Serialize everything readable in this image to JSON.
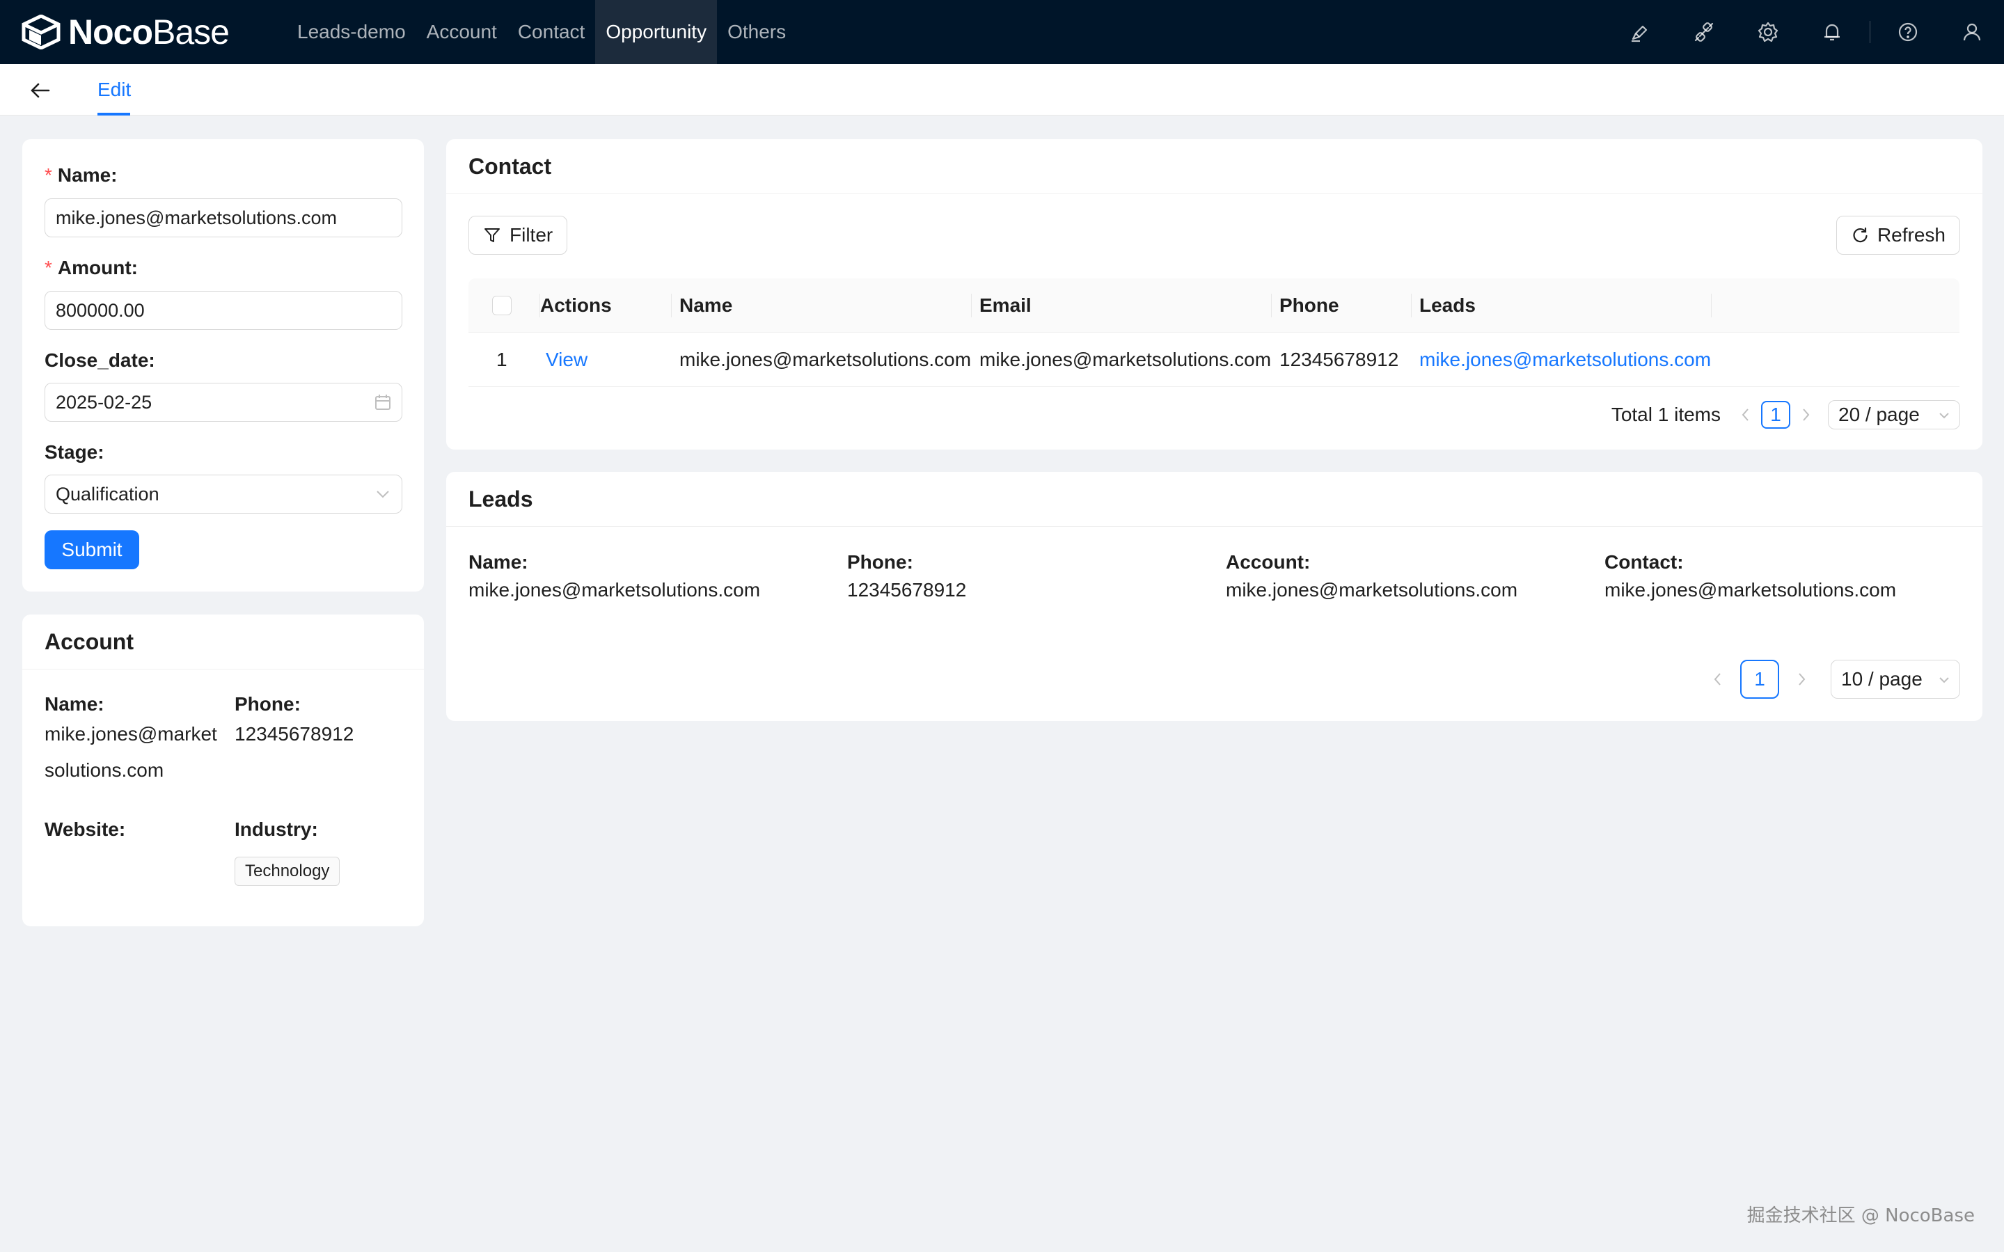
{
  "brand": {
    "name_bold": "Noco",
    "name_light": "Base"
  },
  "nav": [
    {
      "label": "Leads-demo"
    },
    {
      "label": "Account"
    },
    {
      "label": "Contact"
    },
    {
      "label": "Opportunity",
      "active": true
    },
    {
      "label": "Others"
    }
  ],
  "top_icons": [
    "ui-editor-icon",
    "plugin-icon",
    "settings-icon",
    "notification-bell-icon",
    "help-icon",
    "user-icon"
  ],
  "subheader": {
    "tab": "Edit"
  },
  "form": {
    "name_label": "Name",
    "name_value": "mike.jones@marketsolutions.com",
    "amount_label": "Amount",
    "amount_value": "800000.00",
    "close_date_label": "Close_date",
    "close_date_value": "2025-02-25",
    "stage_label": "Stage",
    "stage_value": "Qualification",
    "submit_label": "Submit"
  },
  "account": {
    "title": "Account",
    "name_label": "Name",
    "name_value": "mike.jones@marketsolutions.com",
    "phone_label": "Phone",
    "phone_value": "12345678912",
    "website_label": "Website",
    "website_value": "",
    "industry_label": "Industry",
    "industry_value": "Technology"
  },
  "contact": {
    "title": "Contact",
    "filter_label": "Filter",
    "refresh_label": "Refresh",
    "columns": [
      "Actions",
      "Name",
      "Email",
      "Phone",
      "Leads"
    ],
    "rows": [
      {
        "index": "1",
        "action": "View",
        "name": "mike.jones@marketsolutions.com",
        "email": "mike.jones@marketsolutions.com",
        "phone": "12345678912",
        "leads": "mike.jones@marketsolutions.com"
      }
    ],
    "pagination": {
      "total": "Total 1 items",
      "current": "1",
      "page_size": "20 / page"
    }
  },
  "leads": {
    "title": "Leads",
    "name_label": "Name",
    "name_value": "mike.jones@marketsolutions.com",
    "phone_label": "Phone",
    "phone_value": "12345678912",
    "account_label": "Account",
    "account_value": "mike.jones@marketsolutions.com",
    "contact_label": "Contact",
    "contact_value": "mike.jones@marketsolutions.com",
    "pagination": {
      "current": "1",
      "page_size": "10 / page"
    }
  },
  "watermark": "掘金技术社区 @ NocoBase",
  "colors": {
    "topbar": "#001529",
    "primary": "#1677ff",
    "background": "#f0f2f5",
    "required": "#ff4d4f"
  }
}
